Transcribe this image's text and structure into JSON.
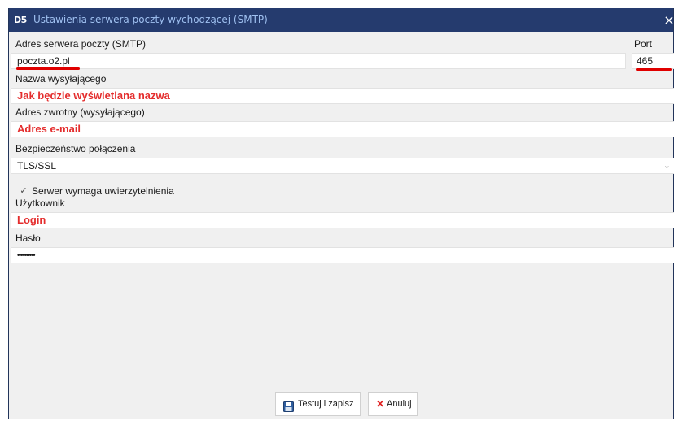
{
  "window": {
    "logo": "D5",
    "title": "Ustawienia serwera poczty wychodzącej (SMTP)",
    "close": "×"
  },
  "form": {
    "server_label": "Adres serwera poczty (SMTP)",
    "server_value": "poczta.o2.pl",
    "port_label": "Port",
    "port_value": "465",
    "sender_name_label": "Nazwa wysyłającego",
    "sender_name_value": "Jak będzie wyświetlana nazwa",
    "reply_address_label": "Adres zwrotny (wysyłającego)",
    "reply_address_value": "Adres e-mail",
    "security_label": "Bezpieczeństwo połączenia",
    "security_value": "TLS/SSL",
    "auth_checkbox_label": "Serwer wymaga uwierzytelnienia",
    "auth_checked": true,
    "user_label": "Użytkownik",
    "user_value": "Login",
    "password_label": "Hasło",
    "password_value": "••••••••••"
  },
  "buttons": {
    "save_label": "Testuj i zapisz",
    "cancel_label": "Anuluj",
    "save_icon": "floppy-disk-icon",
    "cancel_icon": "x-icon"
  },
  "colors": {
    "titlebar": "#253b6e",
    "annotation_red": "#e42d2d"
  }
}
